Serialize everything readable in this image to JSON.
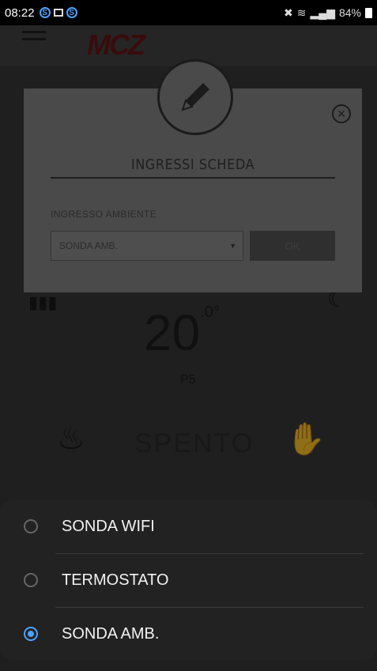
{
  "status_bar": {
    "time": "08:22",
    "right_text": "84%",
    "icons": [
      "s-notification-icon",
      "image-notification-icon",
      "s-notification-icon",
      "mute-icon",
      "wifi-icon",
      "signal-icon",
      "battery-icon"
    ]
  },
  "background_app": {
    "brand": "MCZ",
    "temperature": "20",
    "temperature_decimal": ".0°",
    "power_level": "P5",
    "status": "SPENTO"
  },
  "dialog": {
    "title": "INGRESSI SCHEDA",
    "field_label": "INGRESSO AMBIENTE",
    "select_value": "SONDA AMB.",
    "ok_label": "OK"
  },
  "sheet": {
    "options": [
      {
        "label": "SONDA WIFI",
        "checked": false
      },
      {
        "label": "TERMOSTATO",
        "checked": false
      },
      {
        "label": "SONDA AMB.",
        "checked": true
      }
    ]
  },
  "colors": {
    "accent": "#4da3ff",
    "sheet_bg": "#222222",
    "dialog_bg": "#4a4a4a"
  }
}
